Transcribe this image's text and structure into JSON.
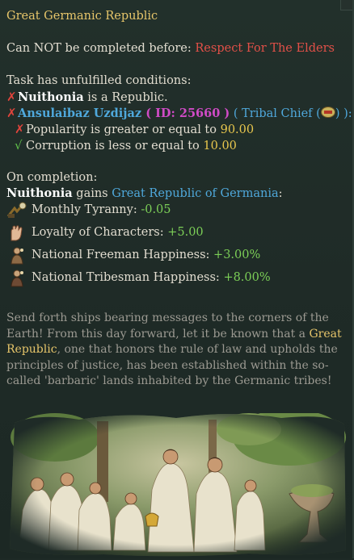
{
  "title": "Great Germanic Republic",
  "prereq": {
    "prefix": "Can NOT be completed before: ",
    "mission": "Respect For The Elders"
  },
  "conditions": {
    "header": "Task has unfulfilled conditions:",
    "republic": {
      "subject": "Nuithonia",
      "text": " is a Republic."
    },
    "character": {
      "name": "Ansulaibaz Uzdijaz",
      "id_prefix": " ( ID: ",
      "id": "25660",
      "id_suffix": " )",
      "role_open": " ( Tribal Chief (",
      "role_close": ") ):"
    },
    "popularity": {
      "text": "Popularity is greater or equal to ",
      "value": "90.00"
    },
    "corruption": {
      "text": "Corruption is less or equal to ",
      "value": "10.00"
    }
  },
  "completion": {
    "header": "On completion:",
    "country": "Nuithonia",
    "gains": " gains ",
    "modifier": "Great Republic of Germania",
    "colon": ":",
    "effects": [
      {
        "icon": "tyranny-icon",
        "label": "Monthly Tyranny: ",
        "value": "-0.05"
      },
      {
        "icon": "loyalty-hand-icon",
        "label": "Loyalty of Characters: ",
        "value": "+5.00"
      },
      {
        "icon": "freeman-pop-icon",
        "label": "National Freeman Happiness: ",
        "value": "+3.00%"
      },
      {
        "icon": "tribesman-pop-icon",
        "label": "National Tribesman Happiness: ",
        "value": "+8.00%"
      }
    ]
  },
  "flavor": {
    "part1": "Send forth ships bearing messages to the corners of the Earth! From this day forward, let it be known that a ",
    "highlight": "Great Republic",
    "part2": ", one that honors the rule of law and upholds the principles of justice, has been established within the so-called 'barbaric' lands inhabited by the Germanic tribes!"
  },
  "colors": {
    "title": "#e6c56a",
    "failed": "#e25048",
    "link": "#4fa8db",
    "positive": "#7ccf57",
    "value": "#e8c74d"
  }
}
